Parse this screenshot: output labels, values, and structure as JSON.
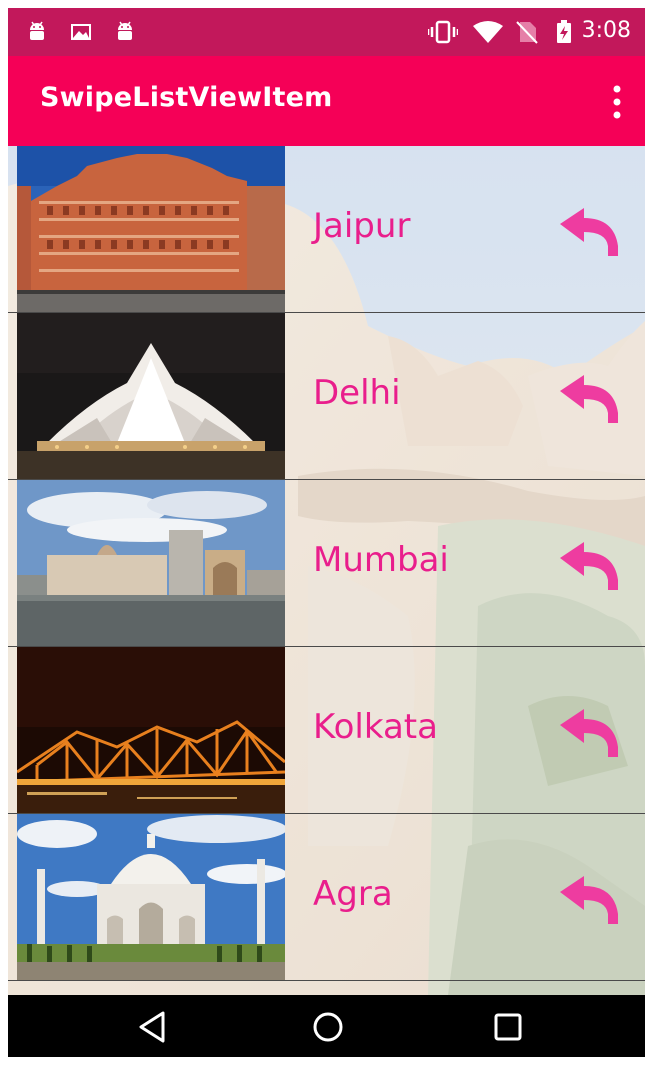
{
  "status_bar": {
    "time": "3:08",
    "left_icons": [
      "android-icon",
      "image-icon",
      "android-icon"
    ],
    "right_icons": [
      "vibrate-icon",
      "wifi-icon",
      "no-sim-icon",
      "battery-charging-icon"
    ]
  },
  "toolbar": {
    "title": "SwipeListViewItem",
    "menu_icon": "more-vert-icon"
  },
  "list": {
    "items": [
      {
        "city": "Jaipur",
        "action_icon": "undo-arrow-icon"
      },
      {
        "city": "Delhi",
        "action_icon": "undo-arrow-icon"
      },
      {
        "city": "Mumbai",
        "action_icon": "undo-arrow-icon"
      },
      {
        "city": "Kolkata",
        "action_icon": "undo-arrow-icon"
      },
      {
        "city": "Agra",
        "action_icon": "undo-arrow-icon"
      }
    ]
  },
  "nav_bar": {
    "buttons": [
      "back-icon",
      "home-icon",
      "recents-icon"
    ]
  },
  "colors": {
    "status_bar": "#c2185b",
    "toolbar": "#f50057",
    "accent_text": "#e91e8c",
    "nav_bar": "#000000"
  }
}
